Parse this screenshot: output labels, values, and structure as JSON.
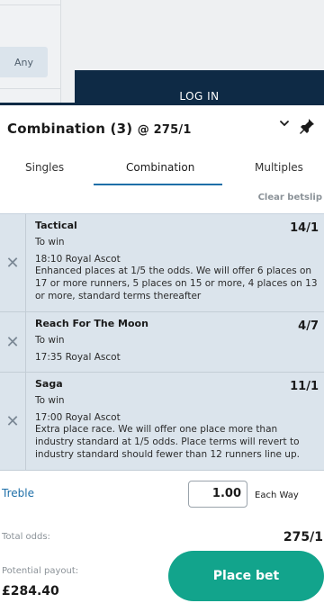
{
  "background": {
    "filter_button": "Any",
    "login_button": "LOG IN"
  },
  "betslip": {
    "title_name": "Combination (3)",
    "title_at": "@ 275/1",
    "tabs": [
      "Singles",
      "Combination",
      "Multiples"
    ],
    "active_tab": "Combination",
    "clear_label": "Clear betslip",
    "selections": [
      {
        "name": "Tactical",
        "odds": "14/1",
        "market": "To win",
        "event": "18:10 Royal Ascot",
        "note": "Enhanced places at 1/5 the odds. We will offer 6 places on 17 or more runners, 5 places on 15 or more, 4 places on 13 or more, standard terms thereafter"
      },
      {
        "name": "Reach For The Moon",
        "odds": "4/7",
        "market": "To win",
        "event": "17:35 Royal Ascot",
        "note": ""
      },
      {
        "name": "Saga",
        "odds": "11/1",
        "market": "To win",
        "event": "17:00 Royal Ascot",
        "note": "Extra place race. We will offer one place more than industry standard at 1/5 odds. Place terms will revert to industry standard should fewer than 12 runners line up."
      }
    ],
    "bet_type": "Treble",
    "stake_value": "1.00",
    "each_way_label": "Each Way",
    "total_odds_label": "Total odds:",
    "total_odds_value": "275/1",
    "payout_label": "Potential payout:",
    "payout_value": "£284.40",
    "place_bet_label": "Place bet",
    "colors": {
      "accent_navy": "#0e2a45",
      "tab_blue": "#1e6fa8",
      "selection_bg": "#dbe4ec",
      "place_bet_green": "#12a48c"
    }
  }
}
